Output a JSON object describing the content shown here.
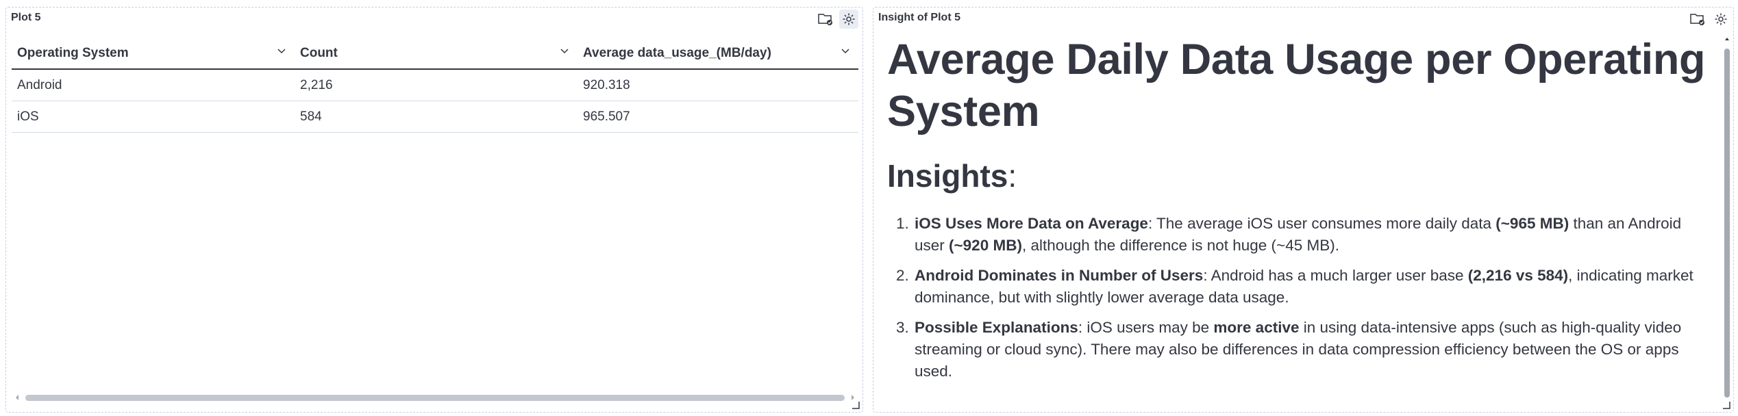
{
  "plot_panel": {
    "title": "Plot 5",
    "table": {
      "columns": [
        "Operating System",
        "Count",
        "Average data_usage_(MB/day)"
      ],
      "rows": [
        [
          "Android",
          "2,216",
          "920.318"
        ],
        [
          "iOS",
          "584",
          "965.507"
        ]
      ]
    }
  },
  "insight_panel": {
    "title": "Insight of Plot 5",
    "heading": "Average Daily Data Usage per Operating System",
    "subheading": "Insights",
    "subheading_suffix": ":",
    "items": [
      {
        "bold": "iOS Uses More Data on Average",
        "parts": [
          {
            "t": ": The average iOS user consumes more daily data "
          },
          {
            "b": "(~965 MB)"
          },
          {
            "t": " than an Android user "
          },
          {
            "b": "(~920 MB)"
          },
          {
            "t": ", although the difference is not huge (~45 MB)."
          }
        ]
      },
      {
        "bold": "Android Dominates in Number of Users",
        "parts": [
          {
            "t": ": Android has a much larger user base "
          },
          {
            "b": "(2,216 vs 584)"
          },
          {
            "t": ", indicating market dominance, but with slightly lower average data usage."
          }
        ]
      },
      {
        "bold": "Possible Explanations",
        "parts": [
          {
            "t": ": iOS users may be "
          },
          {
            "b": "more active"
          },
          {
            "t": " in using data-intensive apps (such as high-quality video streaming or cloud sync). There may also be differences in data compression efficiency between the OS or apps used."
          }
        ]
      }
    ]
  },
  "icons": {
    "folder": "folder-check-icon",
    "settings": "gear-icon"
  }
}
